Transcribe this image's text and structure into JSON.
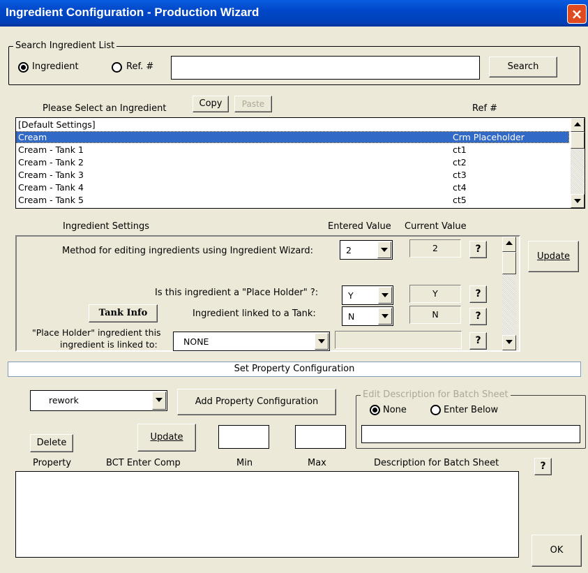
{
  "window": {
    "title": "Ingredient Configuration - Production Wizard",
    "close": "×"
  },
  "search": {
    "legend": "Search Ingredient List",
    "radio_ingredient": "Ingredient",
    "radio_ref": "Ref. #",
    "selected": "ingredient",
    "query": "",
    "button": "Search"
  },
  "select": {
    "label": "Please Select an Ingredient",
    "copy": "Copy",
    "paste": "Paste",
    "ref_header": "Ref #",
    "items": [
      {
        "name": "[Default Settings]",
        "ref": ""
      },
      {
        "name": "Cream",
        "ref": "Crm Placeholder"
      },
      {
        "name": "Cream - Tank 1",
        "ref": "ct1"
      },
      {
        "name": "Cream - Tank 2",
        "ref": "ct2"
      },
      {
        "name": "Cream - Tank 3",
        "ref": "ct3"
      },
      {
        "name": "Cream - Tank 4",
        "ref": "ct4"
      },
      {
        "name": "Cream - Tank 5",
        "ref": "ct5"
      }
    ],
    "selected_index": 1
  },
  "settings": {
    "header": "Ingredient Settings",
    "entered_header": "Entered Value",
    "current_header": "Current Value",
    "update": "Update",
    "tank_info": "Tank Info",
    "help": "?",
    "method_label": "Method for editing ingredients using Ingredient Wizard:",
    "method_entered": "2",
    "method_current": "2",
    "placeholder_label": "Is this ingredient a \"Place Holder\" ?:",
    "placeholder_entered": "Y",
    "placeholder_current": "Y",
    "tank_label": "Ingredient linked to a Tank:",
    "tank_entered": "N",
    "tank_current": "N",
    "linked_label_1": "\"Place Holder\" ingredient this",
    "linked_label_2": "ingredient is linked to:",
    "linked_value": "NONE",
    "linked_current": ""
  },
  "property": {
    "section": "Set Property Configuration",
    "combo_value": "rework",
    "add": "Add Property Configuration",
    "update": "Update",
    "delete": "Delete",
    "min_value": "",
    "max_value": "",
    "desc_legend": "Edit Description for Batch Sheet",
    "radio_none": "None",
    "radio_enter": "Enter Below",
    "desc_selected": "none",
    "desc_value": "",
    "col_property": "Property",
    "col_bct": "BCT Enter Comp",
    "col_min": "Min",
    "col_max": "Max",
    "col_desc": "Description for Batch Sheet",
    "help": "?",
    "rows": []
  },
  "ok": "OK"
}
